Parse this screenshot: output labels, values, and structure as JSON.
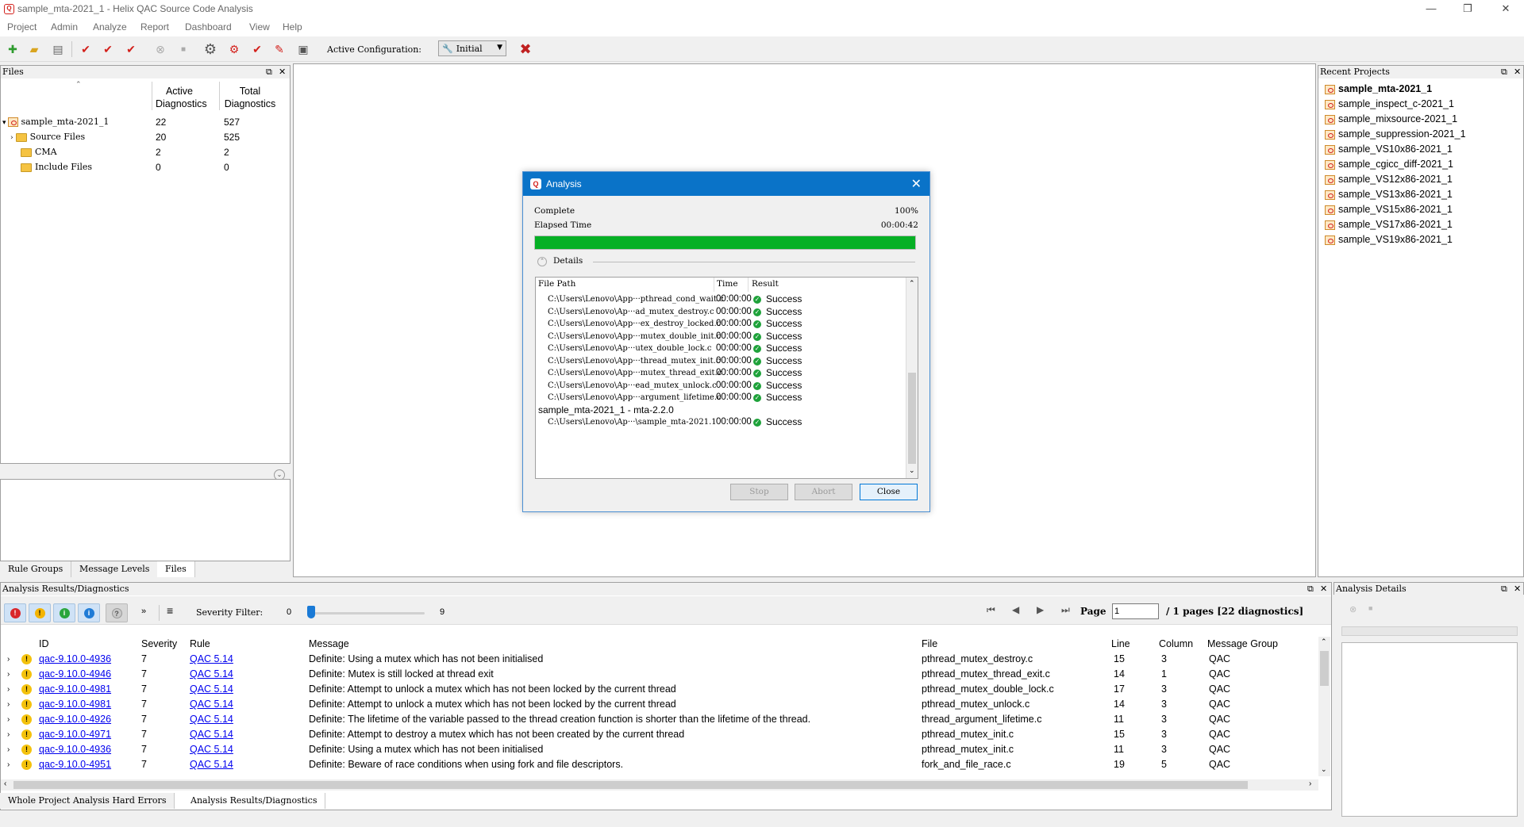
{
  "window": {
    "title": "sample_mta-2021_1 - Helix QAC Source Code Analysis",
    "minimize": "—",
    "restore": "❐",
    "close": "✕"
  },
  "menu": [
    "Project",
    "Admin",
    "Analyze",
    "Report",
    "Dashboard",
    "View",
    "Help"
  ],
  "toolbar": {
    "active_config_label": "Active Configuration:",
    "active_config_value": "Initial"
  },
  "files_panel": {
    "title": "Files",
    "col_active": [
      "Active",
      "Diagnostics"
    ],
    "col_total": [
      "Total",
      "Diagnostics"
    ],
    "rows": [
      {
        "name": "sample_mta-2021_1",
        "active": "22",
        "total": "527"
      },
      {
        "name": "Source Files",
        "active": "20",
        "total": "525"
      },
      {
        "name": "CMA",
        "active": "2",
        "total": "2"
      },
      {
        "name": "Include Files",
        "active": "0",
        "total": "0"
      }
    ],
    "tabs": [
      "Rule Groups",
      "Message Levels",
      "Files"
    ]
  },
  "recent_panel": {
    "title": "Recent Projects",
    "items": [
      "sample_mta-2021_1",
      "sample_inspect_c-2021_1",
      "sample_mixsource-2021_1",
      "sample_suppression-2021_1",
      "sample_VS10x86-2021_1",
      "sample_cgicc_diff-2021_1",
      "sample_VS12x86-2021_1",
      "sample_VS13x86-2021_1",
      "sample_VS15x86-2021_1",
      "sample_VS17x86-2021_1",
      "sample_VS19x86-2021_1"
    ]
  },
  "dialog": {
    "title": "Analysis",
    "status": "Complete",
    "percent": "100%",
    "progress": 1.0,
    "elapsed_label": "Elapsed Time",
    "elapsed_value": "00:00:42",
    "details_label": "Details",
    "col_path": "File Path",
    "col_time": "Time",
    "col_result": "Result",
    "rows": [
      {
        "path": "C:\\Users\\Lenovo\\App···pthread_cond_wait.c",
        "time": "00:00:00",
        "result": "Success"
      },
      {
        "path": "C:\\Users\\Lenovo\\Ap···ad_mutex_destroy.c",
        "time": "00:00:00",
        "result": "Success"
      },
      {
        "path": "C:\\Users\\Lenovo\\App···ex_destroy_locked.c",
        "time": "00:00:00",
        "result": "Success"
      },
      {
        "path": "C:\\Users\\Lenovo\\App···mutex_double_init.c",
        "time": "00:00:00",
        "result": "Success"
      },
      {
        "path": "C:\\Users\\Lenovo\\Ap···utex_double_lock.c",
        "time": "00:00:00",
        "result": "Success"
      },
      {
        "path": "C:\\Users\\Lenovo\\App···thread_mutex_init.c",
        "time": "00:00:00",
        "result": "Success"
      },
      {
        "path": "C:\\Users\\Lenovo\\App···mutex_thread_exit.c",
        "time": "00:00:00",
        "result": "Success"
      },
      {
        "path": "C:\\Users\\Lenovo\\Ap···ead_mutex_unlock.c",
        "time": "00:00:00",
        "result": "Success"
      },
      {
        "path": "C:\\Users\\Lenovo\\App···argument_lifetime.c",
        "time": "00:00:00",
        "result": "Success"
      }
    ],
    "group_label": "sample_mta-2021_1 - mta-2.2.0",
    "group_row": {
      "path": "C:\\Users\\Lenovo\\Ap···\\sample_mta-2021.1",
      "time": "00:00:00",
      "result": "Success"
    },
    "btn_stop": "Stop",
    "btn_abort": "Abort",
    "btn_close": "Close"
  },
  "results_panel": {
    "title": "Analysis Results/Diagnostics",
    "severity_filter_label": "Severity Filter:",
    "severity_min": "0",
    "severity_max": "9",
    "page_label": "Page",
    "page_value": "1",
    "page_summary": "/ 1 pages [22 diagnostics]",
    "columns": [
      "ID",
      "Severity",
      "Rule",
      "Message",
      "File",
      "Line",
      "Column",
      "Message Group"
    ],
    "rows": [
      {
        "id": "qac-9.10.0-4936",
        "severity": "7",
        "rule": "QAC 5.14",
        "message": "Definite: Using a mutex which has not been initialised",
        "file": "pthread_mutex_destroy.c",
        "line": "15",
        "column": "3",
        "group": "QAC"
      },
      {
        "id": "qac-9.10.0-4946",
        "severity": "7",
        "rule": "QAC 5.14",
        "message": "Definite: Mutex is still locked at thread exit",
        "file": "pthread_mutex_thread_exit.c",
        "line": "14",
        "column": "1",
        "group": "QAC"
      },
      {
        "id": "qac-9.10.0-4981",
        "severity": "7",
        "rule": "QAC 5.14",
        "message": "Definite: Attempt to unlock a mutex which has not been locked by the current thread",
        "file": "pthread_mutex_double_lock.c",
        "line": "17",
        "column": "3",
        "group": "QAC"
      },
      {
        "id": "qac-9.10.0-4981",
        "severity": "7",
        "rule": "QAC 5.14",
        "message": "Definite: Attempt to unlock a mutex which has not been locked by the current thread",
        "file": "pthread_mutex_unlock.c",
        "line": "14",
        "column": "3",
        "group": "QAC"
      },
      {
        "id": "qac-9.10.0-4926",
        "severity": "7",
        "rule": "QAC 5.14",
        "message": "Definite: The lifetime of the variable passed to the thread creation function is shorter than the lifetime of the thread.",
        "file": "thread_argument_lifetime.c",
        "line": "11",
        "column": "3",
        "group": "QAC"
      },
      {
        "id": "qac-9.10.0-4971",
        "severity": "7",
        "rule": "QAC 5.14",
        "message": "Definite: Attempt to destroy a mutex which has not been created by the current thread",
        "file": "pthread_mutex_init.c",
        "line": "15",
        "column": "3",
        "group": "QAC"
      },
      {
        "id": "qac-9.10.0-4936",
        "severity": "7",
        "rule": "QAC 5.14",
        "message": "Definite: Using a mutex which has not been initialised",
        "file": "pthread_mutex_init.c",
        "line": "11",
        "column": "3",
        "group": "QAC"
      },
      {
        "id": "qac-9.10.0-4951",
        "severity": "7",
        "rule": "QAC 5.14",
        "message": "Definite: Beware of race conditions when using fork and file descriptors.",
        "file": "fork_and_file_race.c",
        "line": "19",
        "column": "5",
        "group": "QAC"
      }
    ],
    "tabs": [
      "Whole Project Analysis Hard Errors",
      "Analysis Results/Diagnostics"
    ]
  },
  "details_panel": {
    "title": "Analysis Details"
  },
  "colors": {
    "dialog_title": "#0a73c8",
    "progress": "#06b025",
    "brand_red": "#d3201b"
  }
}
